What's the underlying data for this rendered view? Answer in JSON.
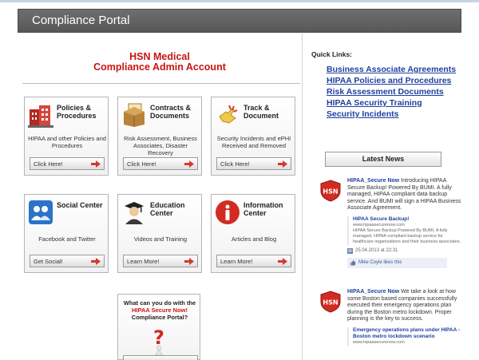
{
  "header": {
    "title": "Compliance Portal"
  },
  "account": {
    "line1": "HSN Medical",
    "line2": "Compliance Admin Account"
  },
  "cards": [
    {
      "title": "Policies & Procedures",
      "desc": "HIPAA and other Policies and Procedures",
      "button": "Click Here!",
      "icon": "building-icon"
    },
    {
      "title": "Contracts & Documents",
      "desc": "Risk Assessment, Business Associates, Disaster Recovery",
      "button": "Click Here!",
      "icon": "file-box-icon"
    },
    {
      "title": "Track & Document",
      "desc": "Security Incidents and ePHI Received and Removed",
      "button": "Click Here!",
      "icon": "hand-cursor-icon"
    },
    {
      "title": "Social Center",
      "desc": "Facebook and Twitter",
      "button": "Get Social!",
      "icon": "chat-people-icon"
    },
    {
      "title": "Education Center",
      "desc": "Videos and Training",
      "button": "Learn More!",
      "icon": "graduate-icon"
    },
    {
      "title": "Information Center",
      "desc": "Articles and Blog",
      "button": "Learn More!",
      "icon": "info-icon"
    }
  ],
  "promo": {
    "text_before": "What can you do with the ",
    "text_highlight": "HIPAA Secure Now!",
    "text_after": " Compliance Portal?",
    "icon": "question-figure-icon"
  },
  "quick_links": {
    "label": "Quick Links:",
    "items": [
      "Business Associate Agreements",
      "HIPAA Policies and Procedures",
      "Risk Assessment Documents",
      "HIPAA Security Training",
      "Security Incidents"
    ]
  },
  "latest_news": {
    "label": "Latest News",
    "posts": [
      {
        "source": "HIPAA_Secure Now",
        "text": " Introducing HIPAA Secure Backup! Powered By BUMI. A fully managed, HIPAA compliant data backup service. And BUMI will sign a HIPAA Business Associate Agreement.",
        "attachment_title": "HIPAA Secure Backup!",
        "attachment_url": "www.hipaasecurenow.com",
        "attachment_desc": "HIPAA Secure Backup Powered By BUMI. A fully managed, HIPAA compliant backup service for healthcare organizations and their business associates.",
        "date": "25.04.2013 at 22:31",
        "likes": "Mike Coyle likes this"
      },
      {
        "source": "HIPAA_Secure Now",
        "text": " We take a look at how some Boston based companies successfully executed their emergency operations plan during the Boston metro lockdown. Proper planning is the key to success.",
        "attachment_title": "Emergency operations plans under HIPAA - Boston metro lockdown scenario",
        "attachment_url": "www.hipaasecurenow.com"
      }
    ]
  },
  "colors": {
    "header_bg": "#5f5f5f",
    "account_red": "#c81414",
    "link_blue": "#1f3f9e",
    "arrow_red": "#d33a2c"
  }
}
